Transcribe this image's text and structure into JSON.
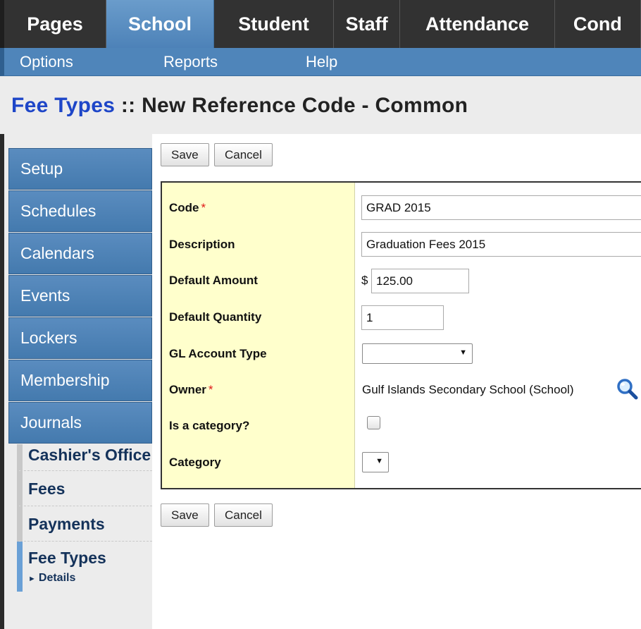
{
  "top_tabs": [
    {
      "label": "Pages",
      "width": 146,
      "active": false
    },
    {
      "label": "School",
      "width": 154,
      "active": true
    },
    {
      "label": "Student",
      "width": 171,
      "active": false
    },
    {
      "label": "Staff",
      "width": 95,
      "active": false
    },
    {
      "label": "Attendance",
      "width": 221,
      "active": false
    },
    {
      "label": "Cond",
      "width": 123,
      "active": false
    }
  ],
  "menu": {
    "options": "Options",
    "reports": "Reports",
    "help": "Help"
  },
  "page": {
    "breadcrumb": "Fee Types",
    "separator": " :: ",
    "title": "New Reference Code - Common"
  },
  "side_nav": [
    "Setup",
    "Schedules",
    "Calendars",
    "Events",
    "Lockers",
    "Membership",
    "Journals"
  ],
  "sub_nav": {
    "items": [
      "Cashier's Office",
      "Fees",
      "Payments"
    ],
    "active": "Fee Types",
    "detail": "Details"
  },
  "buttons": {
    "save": "Save",
    "cancel": "Cancel"
  },
  "form": {
    "required_mark": "*",
    "code": {
      "label": "Code",
      "value": "GRAD 2015"
    },
    "description": {
      "label": "Description",
      "value": "Graduation Fees 2015"
    },
    "default_amount": {
      "label": "Default Amount",
      "currency": "$",
      "value": "125.00"
    },
    "default_quantity": {
      "label": "Default Quantity",
      "value": "1"
    },
    "gl_account_type": {
      "label": "GL Account Type",
      "value": ""
    },
    "owner": {
      "label": "Owner",
      "value": "Gulf Islands Secondary School (School)"
    },
    "is_category": {
      "label": "Is a category?",
      "checked": false
    },
    "category": {
      "label": "Category",
      "value": ""
    }
  },
  "icons": {
    "dropdown_arrow": "▼",
    "detail_arrow": "►",
    "owner_lookup": "magnifier-icon"
  }
}
